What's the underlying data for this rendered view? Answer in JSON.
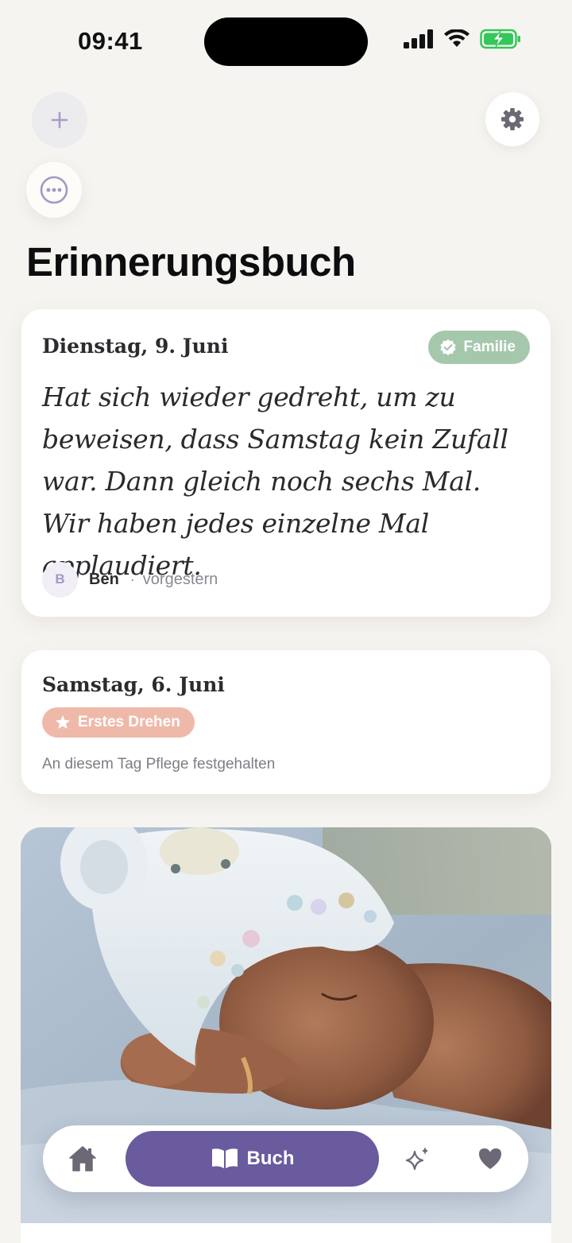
{
  "status_bar": {
    "time": "09:41"
  },
  "header": {
    "title": "Erinnerungsbuch",
    "add_icon": "plus-icon",
    "more_icon": "ellipsis-icon",
    "settings_icon": "gear-icon"
  },
  "entries": [
    {
      "date": "Dienstag, 9. Juni",
      "badge": "Familie",
      "badge_icon": "verified-check-icon",
      "text": "Hat sich wieder gedreht, um zu beweisen, dass Samstag kein Zufall war. Dann gleich noch sechs Mal. Wir haben jedes einzelne Mal applaudiert.",
      "author_initial": "B",
      "author": "Ben",
      "separator": "·",
      "time": "vorgestern"
    },
    {
      "date": "Samstag, 6. Juni",
      "badge": "Erstes Drehen",
      "badge_icon": "star-icon",
      "caption": "An diesem Tag Pflege festgehalten"
    }
  ],
  "photo": {
    "subject": "sleeping-baby-photo"
  },
  "tab_bar": {
    "home_icon": "home-icon",
    "book_label": "Buch",
    "book_icon": "open-book-icon",
    "sparkle_icon": "sparkles-icon",
    "heart_icon": "heart-icon"
  },
  "colors": {
    "background": "#f6f4f0",
    "accent_purple": "#6a5a9e",
    "family_badge": "#a5c8ac",
    "milestone_badge": "#efb9a9",
    "battery_green": "#34c759"
  }
}
